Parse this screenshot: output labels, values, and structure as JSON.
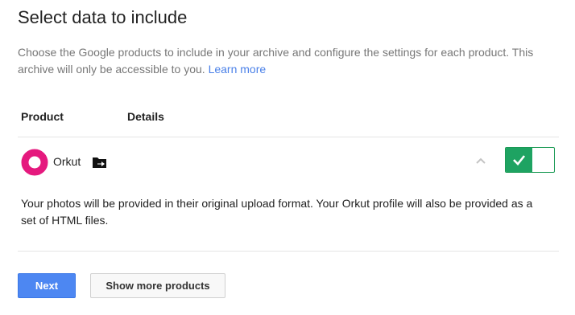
{
  "header": {
    "title": "Select data to include",
    "description": "Choose the Google products to include in your archive and configure the settings for each product. This archive will only be accessible to you.",
    "learn_more": "Learn more"
  },
  "table": {
    "columns": [
      "Product",
      "Details"
    ]
  },
  "product": {
    "name": "Orkut",
    "logo_color": "#e5197e",
    "included": true,
    "toggle_color": "#1ea362",
    "note": "Your photos will be provided in their original upload format. Your Orkut profile will also be provided as a set of HTML files."
  },
  "icons": {
    "folder": "folder-move-icon",
    "collapse": "chevron-up-icon",
    "check": "check-icon"
  },
  "actions": {
    "next_label": "Next",
    "more_label": "Show more products"
  },
  "colors": {
    "accent": "#4d87f2",
    "link": "#4a80e8"
  }
}
